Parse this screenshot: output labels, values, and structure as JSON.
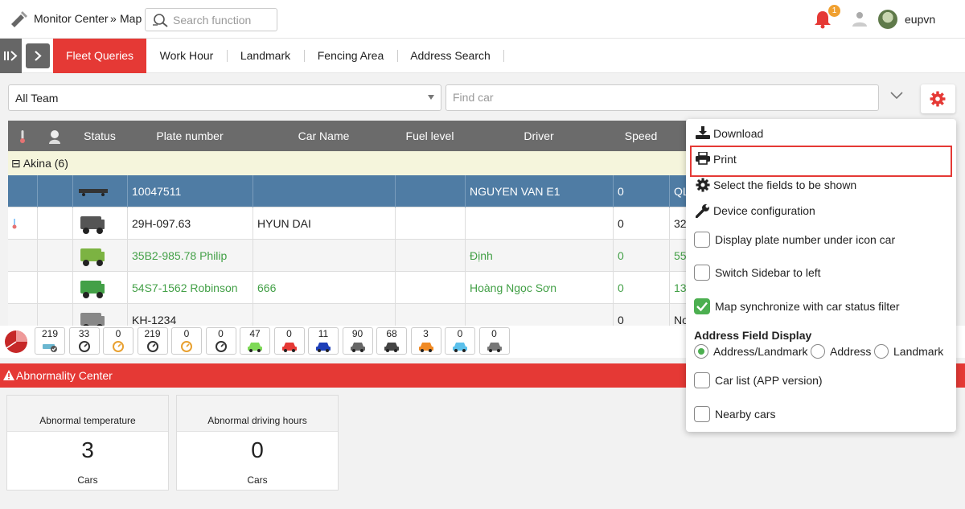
{
  "header": {
    "breadcrumb_root": "Monitor Center",
    "breadcrumb_sep": "»",
    "breadcrumb_current": "Map",
    "search_placeholder": "Search function",
    "notification_count": "1",
    "username": "eupvn"
  },
  "tabs": [
    "Fleet Queries",
    "Work Hour",
    "Landmark",
    "Fencing Area",
    "Address Search"
  ],
  "filters": {
    "team_value": "All Team",
    "find_car_placeholder": "Find car"
  },
  "table": {
    "columns": [
      "Status",
      "Plate number",
      "Car Name",
      "Fuel level",
      "Driver",
      "Speed"
    ],
    "group_label": "⊟ Akina (6)",
    "rows": [
      {
        "plate": "10047511",
        "car_name": "",
        "fuel": "",
        "driver": "NGUYEN VAN E1",
        "speed": "0",
        "extra": "QL",
        "selected": true,
        "green": false
      },
      {
        "plate": "29H-097.63",
        "car_name": "HYUN DAI",
        "fuel": "",
        "driver": "",
        "speed": "0",
        "extra": "32",
        "selected": false,
        "green": false
      },
      {
        "plate": "35B2-985.78 Philip",
        "car_name": "",
        "fuel": "",
        "driver": "Định",
        "speed": "0",
        "extra": "55",
        "selected": false,
        "green": true
      },
      {
        "plate": "54S7-1562 Robinson",
        "car_name": "666",
        "fuel": "",
        "driver": "Hoàng Ngọc Sơn",
        "speed": "0",
        "extra": "13",
        "selected": false,
        "green": true
      },
      {
        "plate": "KH-1234",
        "car_name": "",
        "fuel": "",
        "driver": "",
        "speed": "0",
        "extra": "No",
        "selected": false,
        "green": false
      }
    ]
  },
  "status_counts": [
    {
      "count": "219",
      "icon": "car-check-icon",
      "color": "#6bb7d0"
    },
    {
      "count": "33",
      "icon": "driver-card-icon",
      "color": "#333333"
    },
    {
      "count": "0",
      "icon": "clock-icon",
      "color": "#e8a030"
    },
    {
      "count": "219",
      "icon": "speedometer-icon",
      "color": "#333333"
    },
    {
      "count": "0",
      "icon": "fuel-icon",
      "color": "#e8a030"
    },
    {
      "count": "0",
      "icon": "engine-icon",
      "color": "#333333"
    },
    {
      "count": "47",
      "icon": "car-green-icon",
      "color": "#7ed957"
    },
    {
      "count": "0",
      "icon": "car-red-icon",
      "color": "#e53935"
    },
    {
      "count": "11",
      "icon": "car-blue-icon",
      "color": "#1e3fb8"
    },
    {
      "count": "90",
      "icon": "car-gray-icon",
      "color": "#666666"
    },
    {
      "count": "68",
      "icon": "car-outline-icon",
      "color": "#444444"
    },
    {
      "count": "3",
      "icon": "car-orange-icon",
      "color": "#f08a24"
    },
    {
      "count": "0",
      "icon": "car-lightblue-icon",
      "color": "#5bc0eb"
    },
    {
      "count": "0",
      "icon": "car-darkgray-icon",
      "color": "#777777"
    }
  ],
  "abnormality": {
    "title": "Abnormality Center",
    "cards": [
      {
        "label": "Abnormal temperature",
        "value": "3",
        "unit": "Cars"
      },
      {
        "label": "Abnormal driving hours",
        "value": "0",
        "unit": "Cars"
      }
    ]
  },
  "settings_menu": {
    "download": "Download",
    "print": "Print",
    "select_fields": "Select the fields to be shown",
    "device_config": "Device configuration",
    "opt_plate_under_icon": "Display plate number under icon car",
    "opt_sidebar_left": "Switch Sidebar to left",
    "opt_map_sync": "Map synchronize with car status filter",
    "address_heading": "Address Field Display",
    "radio_address_landmark": "Address/Landmark",
    "radio_address": "Address",
    "radio_landmark": "Landmark",
    "opt_car_list": "Car list (APP version)",
    "opt_nearby": "Nearby cars"
  },
  "colors": {
    "accent": "#e53935",
    "selected_row": "#4f7ca4",
    "header_gray": "#6b6b6b",
    "check_green": "#4caf50"
  }
}
